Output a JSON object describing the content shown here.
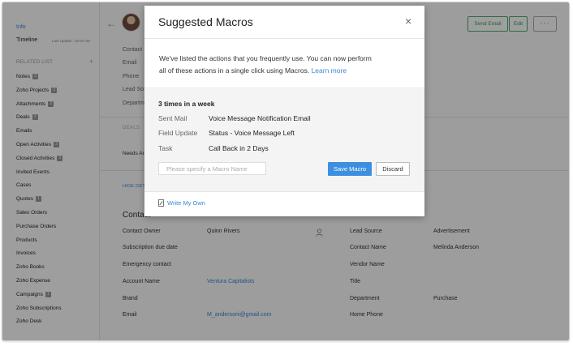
{
  "sidebar": {
    "info": "Info",
    "timeline": "Timeline",
    "last_update": "Last Update : 02:50 AM",
    "related_list": "RELATED LIST",
    "add": "+",
    "items": [
      {
        "label": "Notes",
        "badge": "3"
      },
      {
        "label": "Zoho Projects",
        "badge": "2"
      },
      {
        "label": "Attachments",
        "badge": "2"
      },
      {
        "label": "Deals",
        "badge": "3"
      },
      {
        "label": "Emails",
        "badge": ""
      },
      {
        "label": "Open Activities",
        "badge": "3"
      },
      {
        "label": "Closed Activities",
        "badge": "5"
      },
      {
        "label": "Invited Events",
        "badge": ""
      },
      {
        "label": "Cases",
        "badge": ""
      },
      {
        "label": "Quotes",
        "badge": "1"
      },
      {
        "label": "Sales Orders",
        "badge": ""
      },
      {
        "label": "Purchase Orders",
        "badge": ""
      },
      {
        "label": "Products",
        "badge": ""
      },
      {
        "label": "Invoices",
        "badge": ""
      },
      {
        "label": "Zoho Books",
        "badge": ""
      },
      {
        "label": "Zoho Expense",
        "badge": ""
      },
      {
        "label": "Campaigns",
        "badge": "1"
      },
      {
        "label": "Zoho Subscriptions",
        "badge": ""
      },
      {
        "label": "Zoho Desk",
        "badge": ""
      }
    ]
  },
  "header": {
    "back": "←",
    "send_email": "Send Email",
    "edit": "Edit",
    "more": "···",
    "info_labels": [
      "Contact",
      "Email",
      "Phone",
      "Lead So",
      "Departm"
    ]
  },
  "deals": {
    "label": "DEALS",
    "needs": "Needs An"
  },
  "hide_details": "HIDE DETA",
  "contact": {
    "heading": "Contact",
    "left": [
      {
        "label": "Contact Owner",
        "value": "Quinn Rivers",
        "link": false
      },
      {
        "label": "Subscription due date",
        "value": "",
        "link": false
      },
      {
        "label": "Emergency contact",
        "value": "",
        "link": false
      },
      {
        "label": "Account Name",
        "value": "Ventura Capitalists",
        "link": true
      },
      {
        "label": "Brand",
        "value": "",
        "link": false
      },
      {
        "label": "Email",
        "value": "M_andersoni@gmail.com",
        "link": true
      }
    ],
    "right": [
      {
        "label": "Lead Source",
        "value": "Advertisement"
      },
      {
        "label": "Contact Name",
        "value": "Melinda Anderson"
      },
      {
        "label": "Vendor Name",
        "value": ""
      },
      {
        "label": "Title",
        "value": ""
      },
      {
        "label": "Department",
        "value": "Purchase"
      },
      {
        "label": "Home Phone",
        "value": ""
      }
    ]
  },
  "modal": {
    "title": "Suggested Macros",
    "close": "×",
    "desc_1": "We've listed the actions that you frequently use. You can now perform",
    "desc_2": "all of these actions in a single click using Macros.",
    "learn_more": "Learn more",
    "frequency": "3 times in a week",
    "rows": [
      {
        "label": "Sent Mail",
        "value": "Voice Message Notification Email"
      },
      {
        "label": "Field Update",
        "value": "Status - Voice Message Left"
      },
      {
        "label": "Task",
        "value": "Call Back in 2 Days"
      }
    ],
    "macro_name_placeholder": "Please specify a Macro Name",
    "save_macro": "Save Macro",
    "discard": "Discard",
    "write_own": "Write My Own"
  },
  "colors": {
    "accent": "#3d8fe0",
    "link": "#3a86d9",
    "green": "#4caf6a"
  }
}
